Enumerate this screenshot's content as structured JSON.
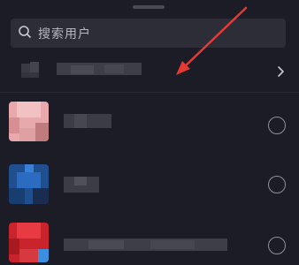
{
  "search": {
    "placeholder": "搜索用户",
    "icon": "search-icon"
  },
  "contacts": [
    {
      "name": "",
      "selected": false
    },
    {
      "name": "",
      "selected": false
    },
    {
      "name": "",
      "selected": false
    }
  ],
  "colors": {
    "background": "#1c1c27",
    "search_bg": "#2d2d38",
    "annotation_arrow": "#e53935"
  }
}
